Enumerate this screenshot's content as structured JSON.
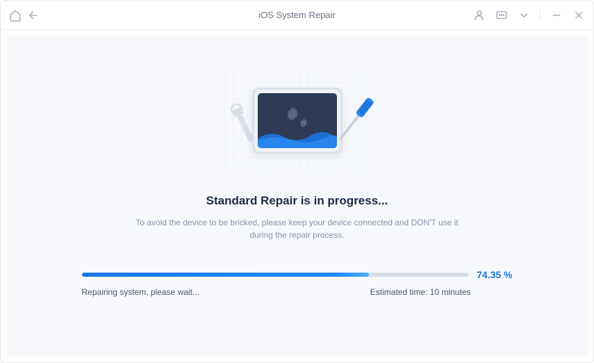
{
  "titlebar": {
    "title": "iOS System Repair"
  },
  "main": {
    "heading": "Standard Repair is in progress...",
    "subtext": "To avoid the device to be bricked, please keep your device connected and DON'T use it during the repair process."
  },
  "progress": {
    "percent_value": 74.35,
    "percent_label": "74.35 %",
    "status_text": "Repairing system, please wait...",
    "estimated_time": "Estimated time: 10 minutes"
  }
}
